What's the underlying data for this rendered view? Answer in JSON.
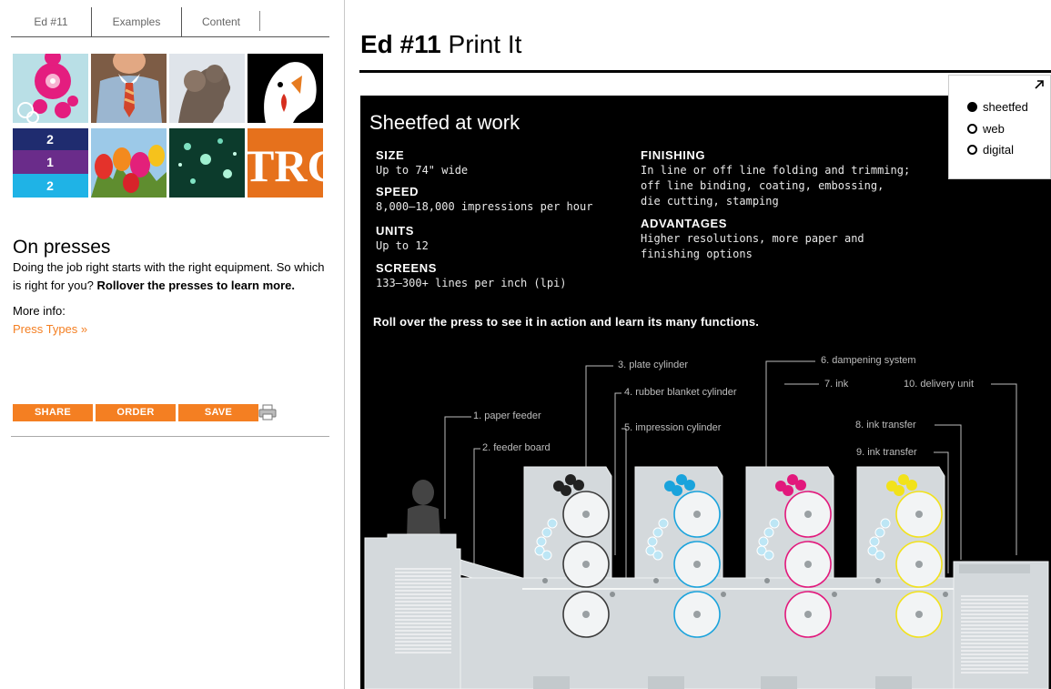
{
  "tabs": [
    {
      "label": "Ed #11"
    },
    {
      "label": "Examples"
    },
    {
      "label": "Content"
    }
  ],
  "sidebar": {
    "heading": "On presses",
    "body_plain": "Doing the job right starts with the right equipment. So which is right for you? ",
    "body_bold": "Rollover the presses to learn more.",
    "more_info_label": "More info:",
    "more_info_link": "Press Types »",
    "thumb_text_1": "2",
    "thumb_text_2": "1",
    "thumb_text_3": "2",
    "thumb_logo": "TRC"
  },
  "actions": {
    "share": "SHARE",
    "order": "ORDER",
    "save": "SAVE"
  },
  "title": {
    "bold": "Ed #11",
    "rest": " Print It"
  },
  "panel": {
    "heading": "Sheetfed at work",
    "specs": {
      "size_label": "SIZE",
      "size_value": "Up to 74\" wide",
      "speed_label": "SPEED",
      "speed_value": "8,000–18,000 impressions per hour",
      "units_label": "UNITS",
      "units_value": "Up to 12",
      "screens_label": "SCREENS",
      "screens_value": "133–300+ lines per inch (lpi)",
      "finishing_label": "FINISHING",
      "finishing_value": "In line or off line folding and trimming;\noff line binding, coating, embossing,\ndie cutting, stamping",
      "advantages_label": "ADVANTAGES",
      "advantages_value": "Higher resolutions, more paper and\nfinishing options"
    },
    "rollover_text": "Roll over the press to see it in action and learn its many functions.",
    "press_labels": {
      "l1": "1. paper feeder",
      "l2": "2. feeder board",
      "l3": "3. plate cylinder",
      "l4": "4. rubber blanket cylinder",
      "l5": "5. impression cylinder",
      "l6": "6. dampening system",
      "l7": "7. ink",
      "l8": "8. ink transfer",
      "l9": "9. ink transfer",
      "l10": "10. delivery unit"
    },
    "ink_colors": {
      "black": "#222222",
      "cyan": "#1aa3dc",
      "magenta": "#e2187c",
      "yellow": "#f2e21a"
    }
  },
  "press_type": {
    "options": [
      {
        "label": "sheetfed",
        "selected": true
      },
      {
        "label": "web",
        "selected": false
      },
      {
        "label": "digital",
        "selected": false
      }
    ]
  },
  "brand": {
    "accent": "#f47f22"
  }
}
